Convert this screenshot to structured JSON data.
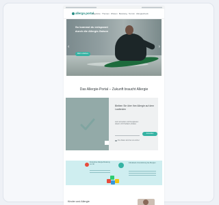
{
  "site": {
    "logo_text": "allergo.portal",
    "nav": [
      "Angebote",
      "Themen",
      "Wissen",
      "Beratung",
      "Termin",
      "Allergiecheck"
    ]
  },
  "hero": {
    "title": "So kommst du entspannt durch die Allergie-Saison",
    "button": "Mehr erfahren"
  },
  "portal": {
    "section_title": "Das Allergie-Portal – Zukunft braucht Allergie",
    "box_title": "Bleiben Sie über Ihre Allergie auf dem Laufenden",
    "subtext": [
      "Jetzt anmelden und Neuigkeiten",
      "direkt in Ihr Postfach erhalten"
    ],
    "button": "Anmelden",
    "note": "Ihre Daten sind bei uns sicher"
  },
  "features": {
    "left_text": "Kostenlose Allergie-Beratung vor Ort",
    "right_text": "Individuelle Unterstützung bei Allergien"
  },
  "bottom": {
    "title": "Kinder und Allergie"
  },
  "colors": {
    "accent": "#35b3a3",
    "brand": "#2a8f86",
    "panel": "#93aaa8",
    "info_bg": "#cfeef0"
  }
}
